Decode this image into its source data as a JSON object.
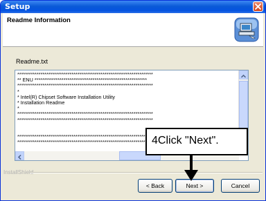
{
  "window": {
    "title": "Setup"
  },
  "header": {
    "title": "Readme Information"
  },
  "readme": {
    "file_label": "Readme.txt",
    "lines": [
      "**********************************************************************",
      "** ENU **********************************************************",
      "**********************************************************************",
      "*",
      "* Intel(R) Chipset Software Installation Utility",
      "* Installation Readme",
      "*",
      "**********************************************************************",
      "**********************************************************************",
      "",
      "",
      "**********************************************************************",
      "**********************************************************************"
    ]
  },
  "footer": {
    "brand": "InstallShield",
    "back_label": "< Back",
    "next_label": "Next >",
    "cancel_label": "Cancel"
  },
  "annotation": {
    "text": "4Click \"Next\"."
  },
  "colors": {
    "titlebar": "#0a5ad7",
    "close": "#d0441c",
    "button_border": "#003c74"
  },
  "icons": [
    "close-icon",
    "setup-computer-icon",
    "scroll-up-icon",
    "scroll-left-icon",
    "pointer-arrow-icon"
  ]
}
